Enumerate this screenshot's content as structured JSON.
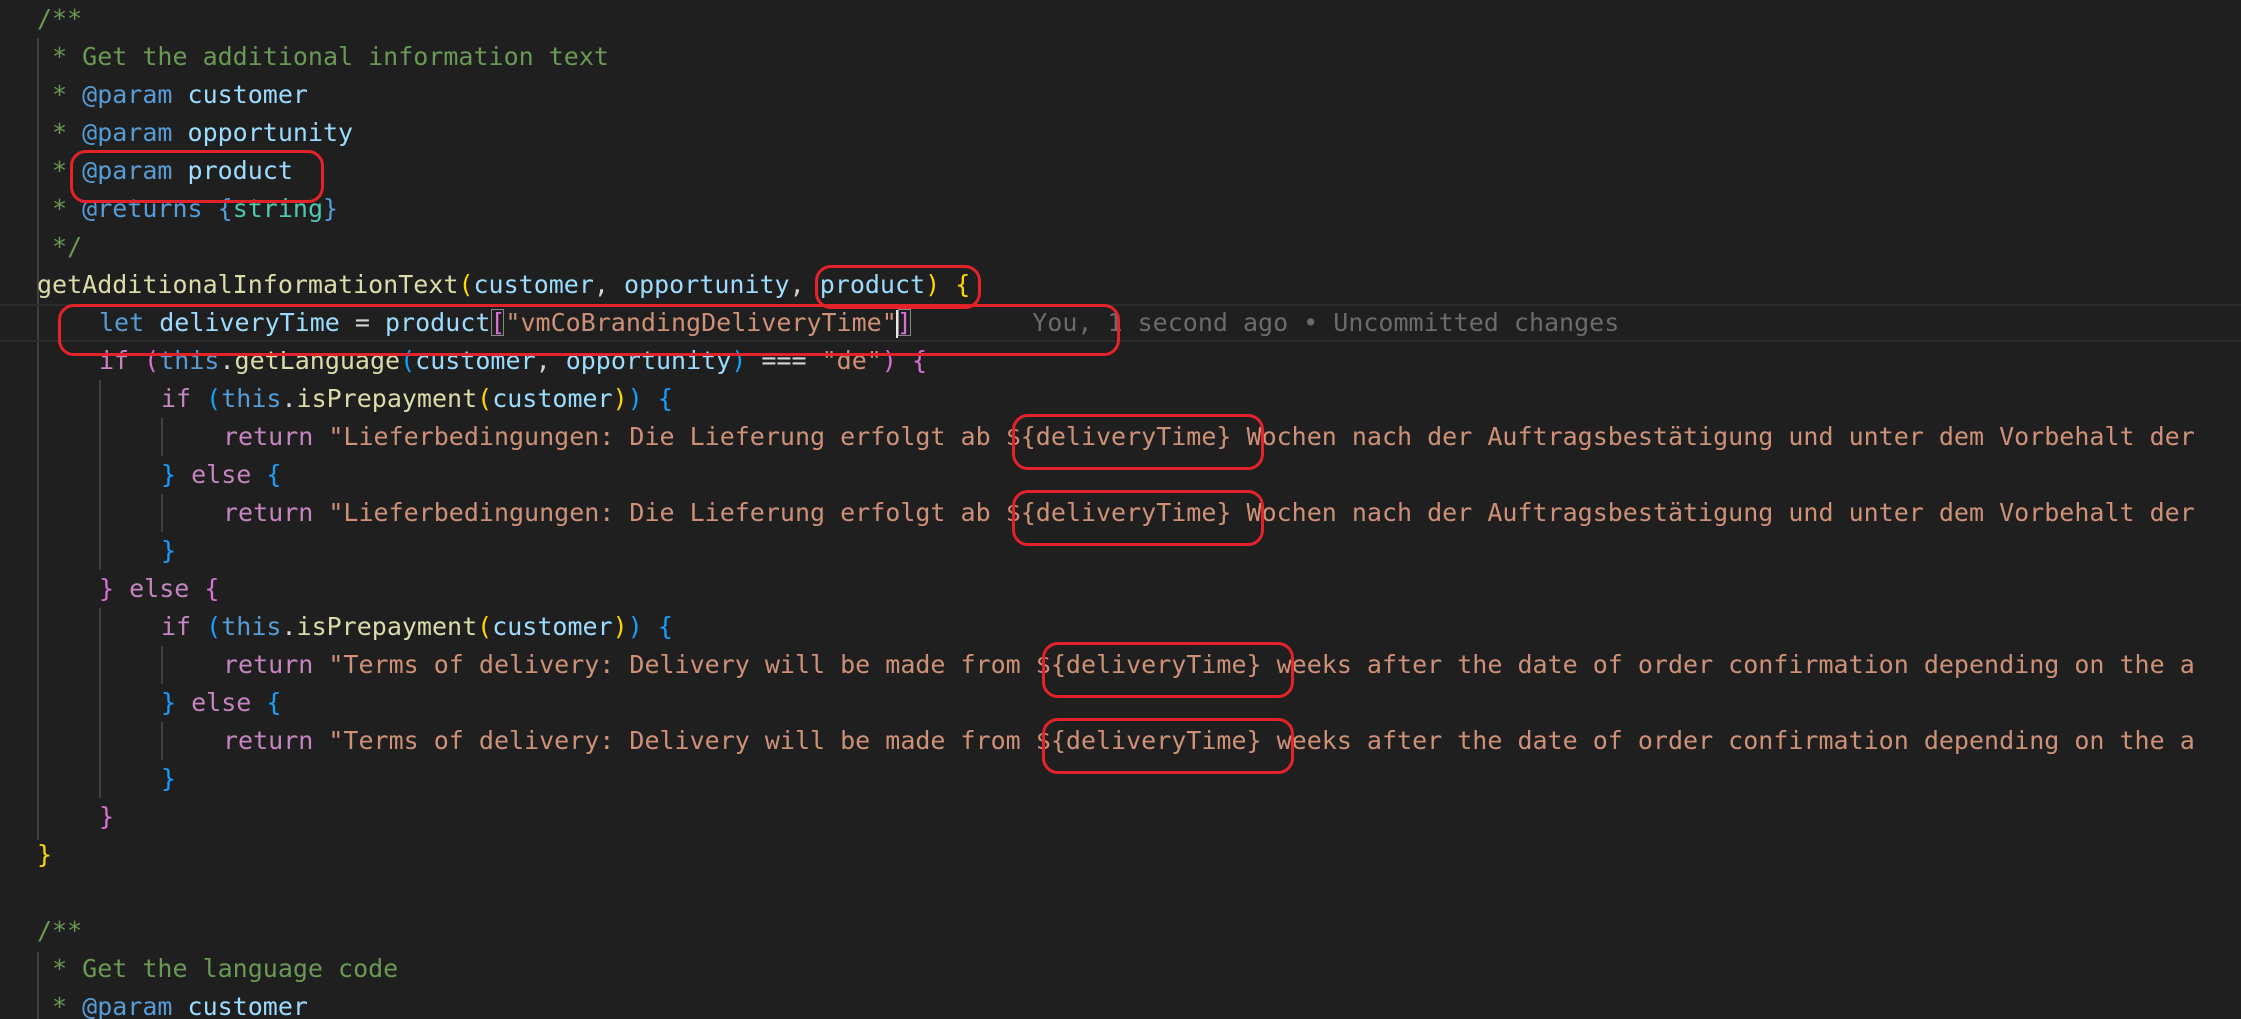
{
  "code": {
    "doc1": {
      "open": "/**",
      "desc": " * Get the additional information text",
      "param_tag": "@param",
      "param1": "customer",
      "param2": "opportunity",
      "param3": "product",
      "returns_tag": "@returns",
      "returns_type": "string",
      "close": " */"
    },
    "fn_name": "getAdditionalInformationText",
    "fn_params": [
      "customer",
      "opportunity",
      "product"
    ],
    "let_kw": "let",
    "var_delivery": "deliveryTime",
    "var_product": "product",
    "key_string": "\"vmCoBrandingDeliveryTime\"",
    "if_kw": "if",
    "else_kw": "else",
    "return_kw": "return",
    "this_kw": "this",
    "get_language": "getLanguage",
    "is_prepayment": "isPrepayment",
    "lang_de": "\"de\"",
    "de_text_before": "\"Lieferbedingungen: Die Lieferung erfolgt ab ",
    "de_text_after": " Wochen nach der Auftragsbestätigung und unter dem Vorbehalt der",
    "en_text_before": "\"Terms of delivery: Delivery will be made from ",
    "en_text_after": " weeks after the date of order confirmation depending on the a",
    "template_var": "${deliveryTime}",
    "doc2": {
      "open": "/**",
      "desc": " * Get the language code",
      "param_tag": "@param",
      "param1": "customer"
    }
  },
  "blame": {
    "text": "You, 1 second ago • Uncommitted changes"
  },
  "colors": {
    "background": "#1f1f1f",
    "comment": "#6a9955",
    "keyword": "#569cd6",
    "control": "#c586c0",
    "string": "#ce9178",
    "function": "#dcdcaa",
    "variable": "#9cdcfe",
    "highlight": "#e3222a"
  }
}
